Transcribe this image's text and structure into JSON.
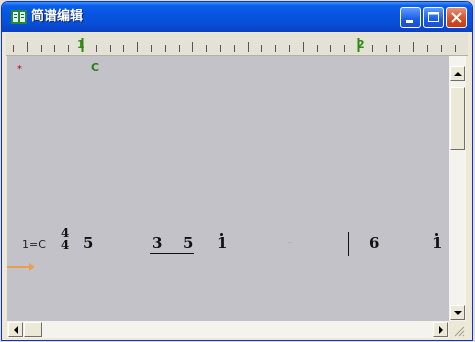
{
  "window": {
    "title": "简谱编辑",
    "icon": "music-notation-app-icon",
    "buttons": [
      "minimize",
      "maximize",
      "close"
    ]
  },
  "ruler": {
    "measure_labels": [
      "1",
      "2"
    ]
  },
  "score": {
    "marker": "*",
    "chord": "C",
    "key": "1=C",
    "time_signature": {
      "numerator": "4",
      "denominator": "4"
    },
    "notes": [
      "5",
      "3",
      "5",
      "1",
      "6",
      "1"
    ]
  },
  "colors": {
    "titlebar": "#0854e3",
    "client_bg": "#c4c2c9",
    "measure_label": "#2e8a12",
    "marker": "#c00000",
    "cursor_arrow": "#e8a050"
  }
}
